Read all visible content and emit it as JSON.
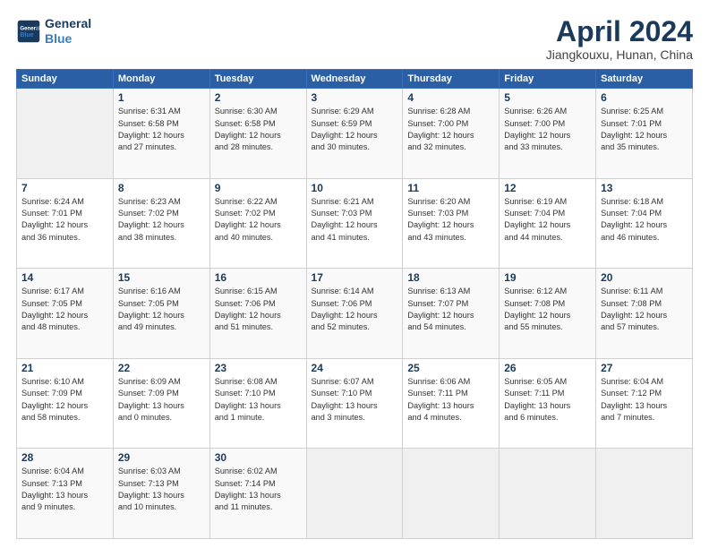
{
  "header": {
    "logo_line1": "General",
    "logo_line2": "Blue",
    "month": "April 2024",
    "location": "Jiangkouxu, Hunan, China"
  },
  "weekdays": [
    "Sunday",
    "Monday",
    "Tuesday",
    "Wednesday",
    "Thursday",
    "Friday",
    "Saturday"
  ],
  "weeks": [
    [
      {
        "day": "",
        "info": ""
      },
      {
        "day": "1",
        "info": "Sunrise: 6:31 AM\nSunset: 6:58 PM\nDaylight: 12 hours\nand 27 minutes."
      },
      {
        "day": "2",
        "info": "Sunrise: 6:30 AM\nSunset: 6:58 PM\nDaylight: 12 hours\nand 28 minutes."
      },
      {
        "day": "3",
        "info": "Sunrise: 6:29 AM\nSunset: 6:59 PM\nDaylight: 12 hours\nand 30 minutes."
      },
      {
        "day": "4",
        "info": "Sunrise: 6:28 AM\nSunset: 7:00 PM\nDaylight: 12 hours\nand 32 minutes."
      },
      {
        "day": "5",
        "info": "Sunrise: 6:26 AM\nSunset: 7:00 PM\nDaylight: 12 hours\nand 33 minutes."
      },
      {
        "day": "6",
        "info": "Sunrise: 6:25 AM\nSunset: 7:01 PM\nDaylight: 12 hours\nand 35 minutes."
      }
    ],
    [
      {
        "day": "7",
        "info": "Sunrise: 6:24 AM\nSunset: 7:01 PM\nDaylight: 12 hours\nand 36 minutes."
      },
      {
        "day": "8",
        "info": "Sunrise: 6:23 AM\nSunset: 7:02 PM\nDaylight: 12 hours\nand 38 minutes."
      },
      {
        "day": "9",
        "info": "Sunrise: 6:22 AM\nSunset: 7:02 PM\nDaylight: 12 hours\nand 40 minutes."
      },
      {
        "day": "10",
        "info": "Sunrise: 6:21 AM\nSunset: 7:03 PM\nDaylight: 12 hours\nand 41 minutes."
      },
      {
        "day": "11",
        "info": "Sunrise: 6:20 AM\nSunset: 7:03 PM\nDaylight: 12 hours\nand 43 minutes."
      },
      {
        "day": "12",
        "info": "Sunrise: 6:19 AM\nSunset: 7:04 PM\nDaylight: 12 hours\nand 44 minutes."
      },
      {
        "day": "13",
        "info": "Sunrise: 6:18 AM\nSunset: 7:04 PM\nDaylight: 12 hours\nand 46 minutes."
      }
    ],
    [
      {
        "day": "14",
        "info": "Sunrise: 6:17 AM\nSunset: 7:05 PM\nDaylight: 12 hours\nand 48 minutes."
      },
      {
        "day": "15",
        "info": "Sunrise: 6:16 AM\nSunset: 7:05 PM\nDaylight: 12 hours\nand 49 minutes."
      },
      {
        "day": "16",
        "info": "Sunrise: 6:15 AM\nSunset: 7:06 PM\nDaylight: 12 hours\nand 51 minutes."
      },
      {
        "day": "17",
        "info": "Sunrise: 6:14 AM\nSunset: 7:06 PM\nDaylight: 12 hours\nand 52 minutes."
      },
      {
        "day": "18",
        "info": "Sunrise: 6:13 AM\nSunset: 7:07 PM\nDaylight: 12 hours\nand 54 minutes."
      },
      {
        "day": "19",
        "info": "Sunrise: 6:12 AM\nSunset: 7:08 PM\nDaylight: 12 hours\nand 55 minutes."
      },
      {
        "day": "20",
        "info": "Sunrise: 6:11 AM\nSunset: 7:08 PM\nDaylight: 12 hours\nand 57 minutes."
      }
    ],
    [
      {
        "day": "21",
        "info": "Sunrise: 6:10 AM\nSunset: 7:09 PM\nDaylight: 12 hours\nand 58 minutes."
      },
      {
        "day": "22",
        "info": "Sunrise: 6:09 AM\nSunset: 7:09 PM\nDaylight: 13 hours\nand 0 minutes."
      },
      {
        "day": "23",
        "info": "Sunrise: 6:08 AM\nSunset: 7:10 PM\nDaylight: 13 hours\nand 1 minute."
      },
      {
        "day": "24",
        "info": "Sunrise: 6:07 AM\nSunset: 7:10 PM\nDaylight: 13 hours\nand 3 minutes."
      },
      {
        "day": "25",
        "info": "Sunrise: 6:06 AM\nSunset: 7:11 PM\nDaylight: 13 hours\nand 4 minutes."
      },
      {
        "day": "26",
        "info": "Sunrise: 6:05 AM\nSunset: 7:11 PM\nDaylight: 13 hours\nand 6 minutes."
      },
      {
        "day": "27",
        "info": "Sunrise: 6:04 AM\nSunset: 7:12 PM\nDaylight: 13 hours\nand 7 minutes."
      }
    ],
    [
      {
        "day": "28",
        "info": "Sunrise: 6:04 AM\nSunset: 7:13 PM\nDaylight: 13 hours\nand 9 minutes."
      },
      {
        "day": "29",
        "info": "Sunrise: 6:03 AM\nSunset: 7:13 PM\nDaylight: 13 hours\nand 10 minutes."
      },
      {
        "day": "30",
        "info": "Sunrise: 6:02 AM\nSunset: 7:14 PM\nDaylight: 13 hours\nand 11 minutes."
      },
      {
        "day": "",
        "info": ""
      },
      {
        "day": "",
        "info": ""
      },
      {
        "day": "",
        "info": ""
      },
      {
        "day": "",
        "info": ""
      }
    ]
  ]
}
